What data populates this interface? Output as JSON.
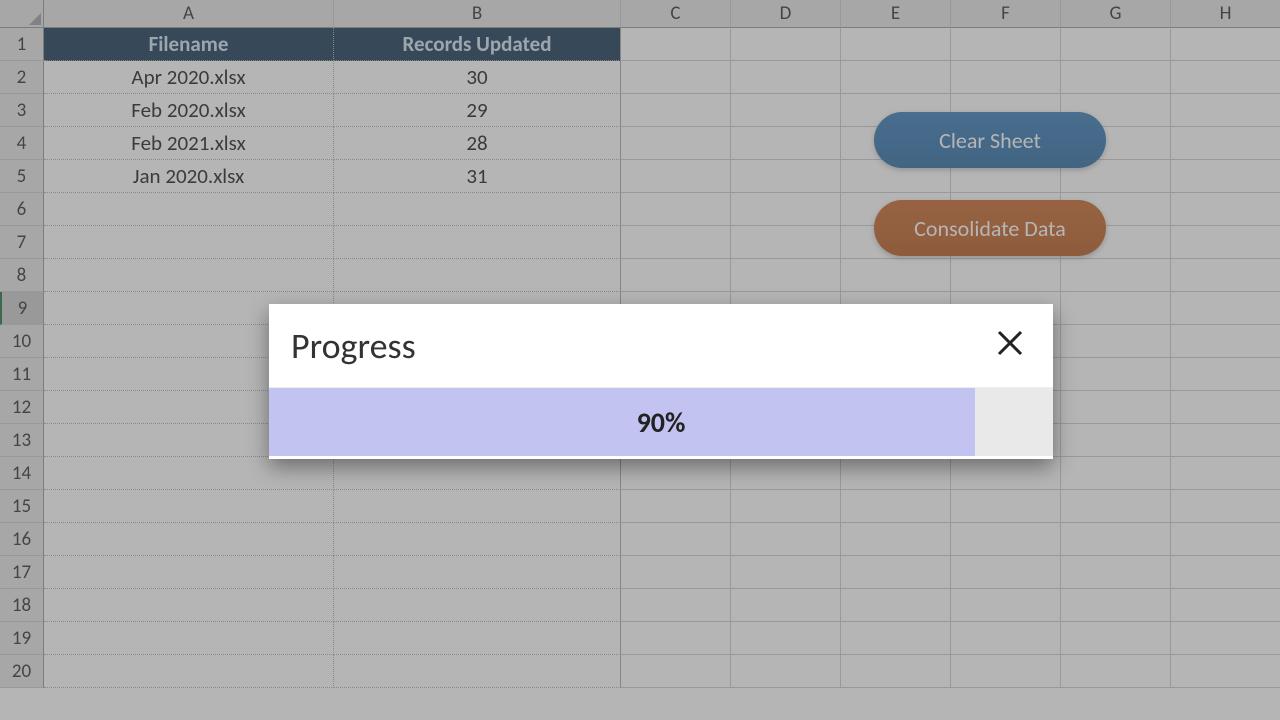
{
  "columns": [
    "A",
    "B",
    "C",
    "D",
    "E",
    "F",
    "G",
    "H"
  ],
  "rows": [
    1,
    2,
    3,
    4,
    5,
    6,
    7,
    8,
    9,
    10,
    11,
    12,
    13,
    14,
    15,
    16,
    17,
    18,
    19,
    20
  ],
  "selected_row": 9,
  "table": {
    "headers": {
      "filename": "Filename",
      "records": "Records Updated"
    },
    "data": [
      {
        "filename": "Apr 2020.xlsx",
        "records": "30"
      },
      {
        "filename": "Feb 2020.xlsx",
        "records": "29"
      },
      {
        "filename": "Feb 2021.xlsx",
        "records": "28"
      },
      {
        "filename": "Jan 2020.xlsx",
        "records": "31"
      }
    ]
  },
  "buttons": {
    "clear": "Clear Sheet",
    "consolidate": "Consolidate Data"
  },
  "dialog": {
    "title": "Progress",
    "percent_text": "90%",
    "percent_value": 90
  }
}
